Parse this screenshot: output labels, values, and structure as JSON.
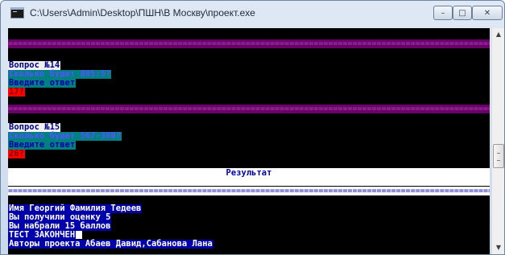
{
  "window": {
    "title": "C:\\Users\\Admin\\Desktop\\ПШН\\В Москву\\проект.exe",
    "min_label": "–",
    "max_label": "□",
    "close_label": "✕"
  },
  "console": {
    "separator_char_line": "=============================================================================================================",
    "q14": {
      "number": "Вопрос №14",
      "question": "Сколько будет 885:5?",
      "prompt": "Введите ответ",
      "answer": "17?"
    },
    "q15": {
      "number": "Вопрос №15",
      "question": "Сколько будет 567-380?",
      "prompt": "Введите ответ",
      "answer": "26?"
    },
    "result_title": "Результат",
    "name_line": "Имя Георгий Фамилия Тедеев",
    "grade_line": "Вы получили оценку 5",
    "score_line": "Вы набрали 15 баллов",
    "finish_line": "ТЕСТ ЗАКОНЧЕН",
    "authors_line": "Авторы проекта Абаев Давид,Сабанова Лана"
  },
  "scrollbar": {
    "up_label": "▲",
    "down_label": "▼"
  }
}
